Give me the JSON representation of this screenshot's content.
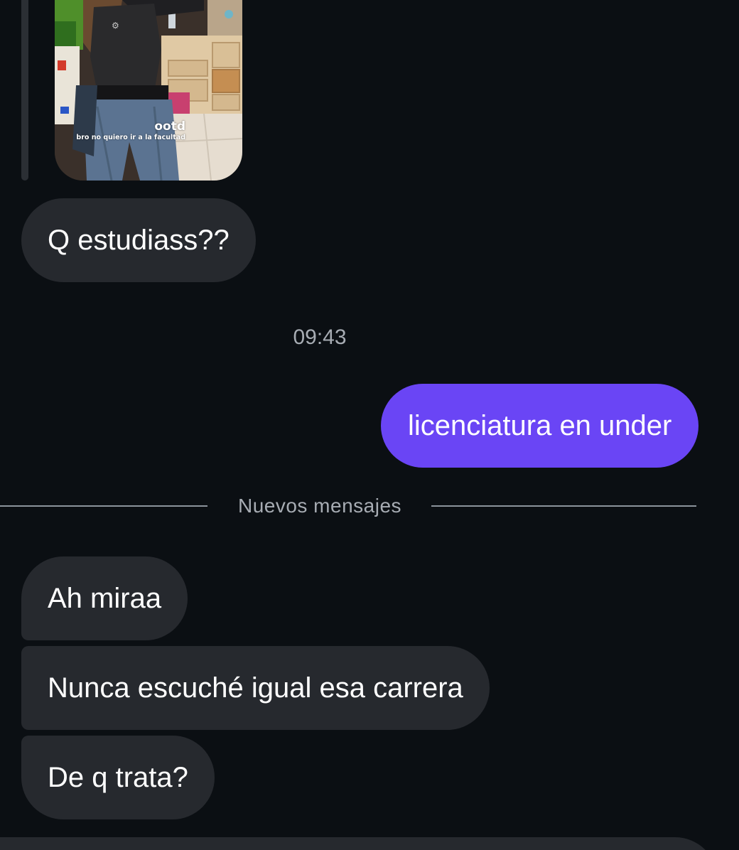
{
  "story_reply": {
    "caption_title": "ootd",
    "caption_subtitle": "bro no quiero ir a la facultad"
  },
  "messages": [
    {
      "id": "m1",
      "direction": "incoming",
      "text": "Q estudiass??"
    },
    {
      "id": "m2",
      "direction": "outgoing",
      "text": "licenciatura en under"
    },
    {
      "id": "m3",
      "direction": "incoming",
      "text": "Ah miraa"
    },
    {
      "id": "m4",
      "direction": "incoming",
      "text": "Nunca escuché igual esa carrera"
    },
    {
      "id": "m5",
      "direction": "incoming",
      "text": "De q trata?"
    }
  ],
  "timestamp": "09:43",
  "divider_label": "Nuevos mensajes",
  "colors": {
    "background": "#0b0f13",
    "incoming_bubble": "#26292e",
    "outgoing_bubble": "#6a45f5",
    "muted_text": "#a7acb3"
  }
}
